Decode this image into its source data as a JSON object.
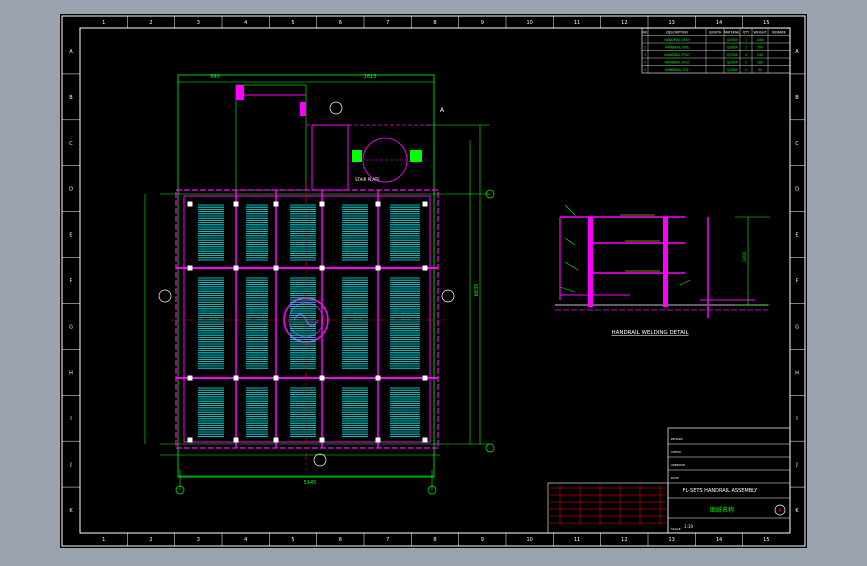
{
  "drawing": {
    "title_line": "FL-SETS HANDRAIL ASSEMBLY",
    "subtitle_glyph": "图纸名称",
    "sheet_code": "A",
    "detail_caption": "HANDRAIL WELDING DETAIL",
    "overall_width": "5145",
    "overall_height": "6835",
    "top_dim_1": "1613",
    "top_dim_2": "540",
    "section_mark": "A",
    "stair_label": "STAIR PLATE"
  },
  "border": {
    "columns": [
      "1",
      "2",
      "3",
      "4",
      "5",
      "6",
      "7",
      "8",
      "9",
      "10",
      "11",
      "12",
      "13",
      "14",
      "15"
    ],
    "rows": [
      "A",
      "B",
      "C",
      "D",
      "E",
      "F",
      "G",
      "H",
      "I",
      "J",
      "K"
    ]
  },
  "parts_table": {
    "headers": [
      "NO",
      "DESCRIPTION",
      "LENGTH",
      "MATERIAL",
      "QTY",
      "WEIGHT",
      "REMARK"
    ],
    "rows": [
      [
        "1",
        "HANDRAIL ASSY",
        "",
        "Q235A",
        "1",
        "1280",
        ""
      ],
      [
        "2",
        "HANDRAIL PIPE",
        "",
        "Q235A",
        "2",
        "350",
        ""
      ],
      [
        "3",
        "HANDRAIL POST",
        "",
        "Q235A",
        "4",
        "240",
        ""
      ],
      [
        "4",
        "HANDRAIL KICK",
        "",
        "Q235A",
        "2",
        "180",
        ""
      ],
      [
        "5",
        "HANDRAIL TOE",
        "",
        "Q235A",
        "1",
        "90",
        ""
      ]
    ]
  },
  "title_block": {
    "rows": [
      "DESIGN",
      "CHECK",
      "APPROVE",
      "DATE",
      "SCALE"
    ],
    "scale": "1:10"
  },
  "colors": {
    "background": "#000000",
    "border": "#ffffff",
    "dims": "#00ff00",
    "structure": "#ff00ff",
    "grating": "#00ffff",
    "text": "#ffffff",
    "redline": "#ff0000",
    "posts": "#ffff00"
  }
}
